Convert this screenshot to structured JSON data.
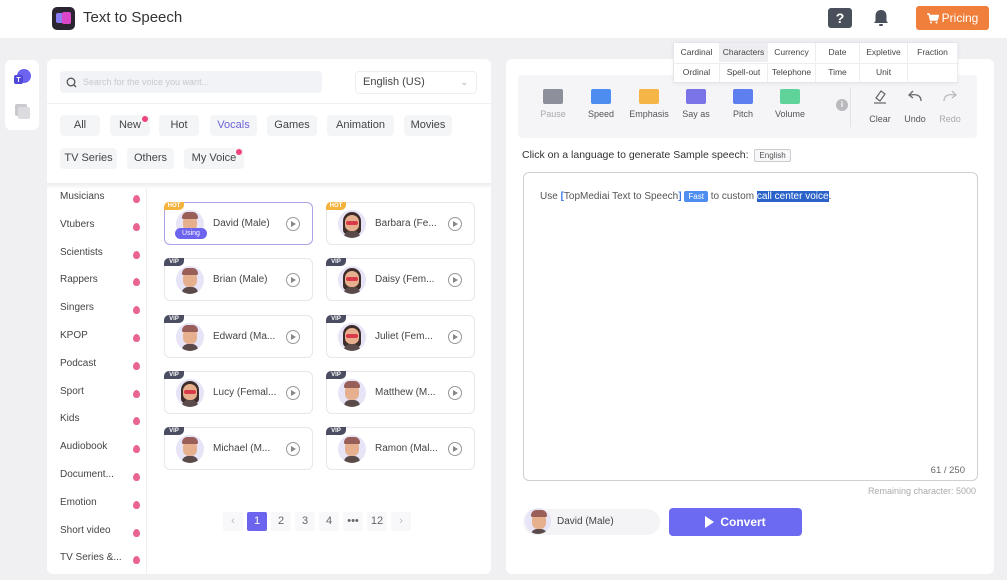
{
  "header": {
    "app_title": "Text to Speech",
    "help_label": "?",
    "pricing_label": "Pricing",
    "icons": [
      "app-logo-icon",
      "help-icon",
      "bell-icon",
      "cart-icon"
    ]
  },
  "left_rail": {
    "items": [
      {
        "name": "text-to-speech",
        "icon": "tts-icon",
        "active": true
      },
      {
        "name": "library",
        "icon": "library-icon",
        "active": false
      }
    ]
  },
  "voice_panel": {
    "search_placeholder": "Search for the voice you want...",
    "search_value": "",
    "language": "English (US)",
    "tabs": [
      {
        "label": "All",
        "active": false,
        "dot": false
      },
      {
        "label": "New",
        "active": false,
        "dot": true
      },
      {
        "label": "Hot",
        "active": false,
        "dot": false
      },
      {
        "label": "Vocals",
        "active": true,
        "dot": false
      },
      {
        "label": "Games",
        "active": false,
        "dot": false
      },
      {
        "label": "Animation",
        "active": false,
        "dot": false
      },
      {
        "label": "Movies",
        "active": false,
        "dot": false
      },
      {
        "label": "TV Series",
        "active": false,
        "dot": false
      },
      {
        "label": "Others",
        "active": false,
        "dot": false
      },
      {
        "label": "My Voice",
        "active": false,
        "dot": true
      }
    ],
    "subcategories": [
      "Musicians",
      "Vtubers",
      "Scientists",
      "Rappers",
      "Singers",
      "KPOP",
      "Podcast",
      "Sport",
      "Kids",
      "Audiobook",
      "Document...",
      "Emotion",
      "Short video",
      "TV Series &..."
    ],
    "voices": [
      {
        "name": "David (Male)",
        "badge": "HOT",
        "gender": "m",
        "using": true
      },
      {
        "name": "Barbara (Fe...",
        "badge": "HOT",
        "gender": "f",
        "using": false
      },
      {
        "name": "Brian (Male)",
        "badge": "VIP",
        "gender": "m",
        "using": false
      },
      {
        "name": "Daisy (Fem...",
        "badge": "VIP",
        "gender": "f",
        "using": false
      },
      {
        "name": "Edward (Ma...",
        "badge": "VIP",
        "gender": "m",
        "using": false
      },
      {
        "name": "Juliet (Fem...",
        "badge": "VIP",
        "gender": "f",
        "using": false
      },
      {
        "name": "Lucy (Femal...",
        "badge": "VIP",
        "gender": "f",
        "using": false
      },
      {
        "name": "Matthew (M...",
        "badge": "VIP",
        "gender": "m",
        "using": false
      },
      {
        "name": "Michael (M...",
        "badge": "VIP",
        "gender": "m",
        "using": false
      },
      {
        "name": "Ramon (Mal...",
        "badge": "VIP",
        "gender": "m",
        "using": false
      }
    ],
    "using_label": "Using",
    "pagination": {
      "prev": "‹",
      "pages": [
        "1",
        "2",
        "3",
        "4",
        "•••",
        "12"
      ],
      "current": "1",
      "next": "›"
    }
  },
  "editor_panel": {
    "tools": [
      {
        "label": "Pause",
        "icon": "pause-icon",
        "color": "#8d909a",
        "dim": true
      },
      {
        "label": "Speed",
        "icon": "speed-icon",
        "color": "#4d8df0",
        "dim": false
      },
      {
        "label": "Emphasis",
        "icon": "emphasis-icon",
        "color": "#f5b547",
        "dim": false
      },
      {
        "label": "Say as",
        "icon": "say-as-icon",
        "color": "#7b74e8",
        "dim": false
      },
      {
        "label": "Pitch",
        "icon": "pitch-icon",
        "color": "#5d7ff0",
        "dim": false
      },
      {
        "label": "Volume",
        "icon": "volume-icon",
        "color": "#5fd39a",
        "dim": false
      }
    ],
    "actions": [
      {
        "label": "Clear",
        "icon": "eraser-icon",
        "dim": false
      },
      {
        "label": "Undo",
        "icon": "undo-icon",
        "dim": false
      },
      {
        "label": "Redo",
        "icon": "redo-icon",
        "dim": true
      }
    ],
    "say_as_options": {
      "row1": [
        "Cardinal",
        "Characters",
        "Currency",
        "Date",
        "Expletive",
        "Fraction"
      ],
      "row2": [
        "Ordinal",
        "Spell-out",
        "Telephone",
        "Time",
        "Unit",
        ""
      ]
    },
    "sample_prompt": "Click on a language to generate Sample speech:",
    "sample_language": "English",
    "text": {
      "prefix": "Use ",
      "bracket_open": "[",
      "product": "TopMediai Text to Speech",
      "bracket_close": "]",
      "tag": "Fast",
      "middle": " to custom ",
      "highlighted": "call center voice",
      "suffix": "."
    },
    "counter": "61 / 250",
    "remaining": "Remaining character: 5000",
    "current_voice": "David (Male)",
    "convert_label": "Convert"
  }
}
